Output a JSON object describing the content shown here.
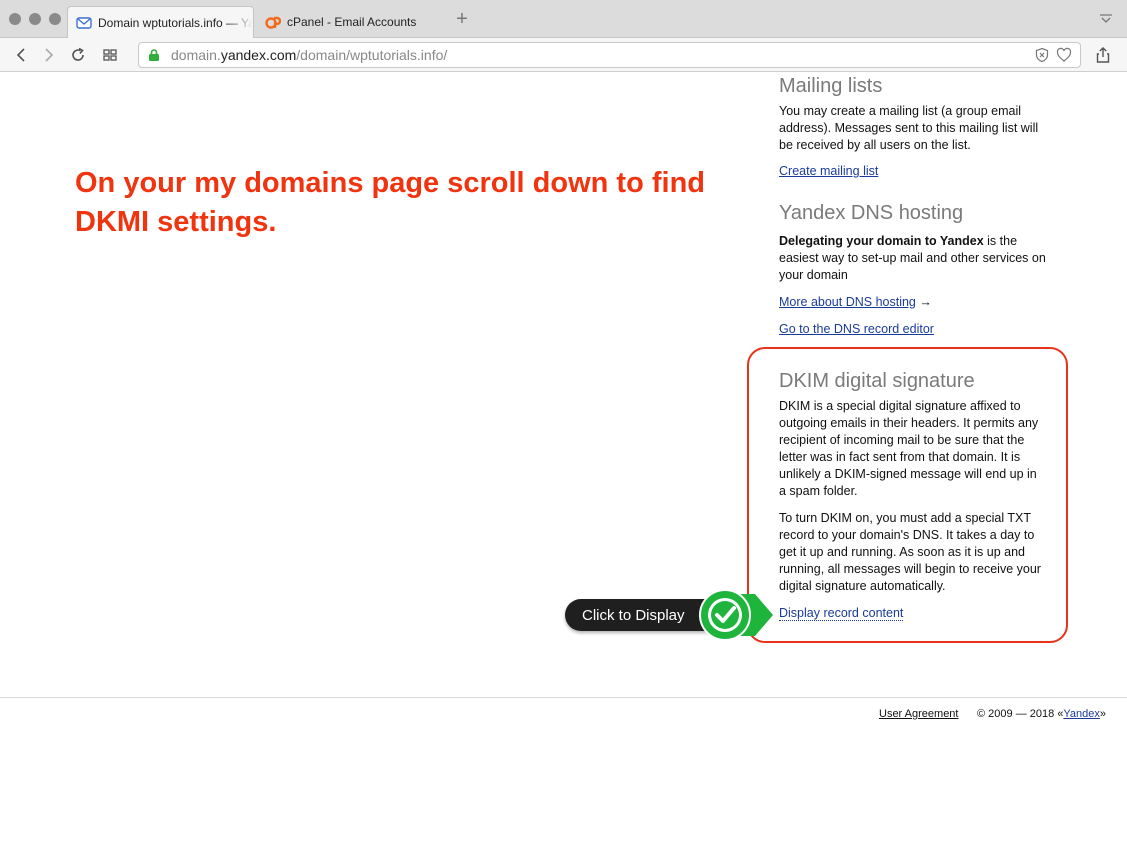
{
  "browser": {
    "tabs": [
      {
        "title": "Domain wptutorials.info — Ya",
        "active": true,
        "icon": "mail-icon"
      },
      {
        "title": "cPanel - Email Accounts",
        "active": false,
        "icon": "cpanel-icon"
      }
    ],
    "address": {
      "prefix": "domain.",
      "host": "yandex.com",
      "path": "/domain/wptutorials.info/"
    }
  },
  "annotation": {
    "text": "On your my domains page scroll down to find DKMI settings."
  },
  "mailing_lists": {
    "title": "Mailing lists",
    "description": "You may create a mailing list (a group email address). Messages sent to this mailing list will be received by all users on the list.",
    "create_link": "Create mailing list"
  },
  "dns_hosting": {
    "title": "Yandex DNS hosting",
    "lead_bold": "Delegating your domain to Yandex",
    "lead_rest": " is the easiest way to set-up mail and other services on your domain",
    "more_link": "More about DNS hosting",
    "arrow": "→",
    "editor_link": "Go to the DNS record editor"
  },
  "dkim": {
    "title": "DKIM digital signature",
    "para1": "DKIM is a special digital signature affixed to outgoing emails in their headers. It permits any recipient of incoming mail to be sure that the letter was in fact sent from that domain. It is unlikely a DKIM-signed message will end up in a spam folder.",
    "para2": "To turn DKIM on, you must add a special TXT record to your domain's DNS. It takes a day to get it up and running. As soon as it is up and running, all messages will begin to receive your digital signature automatically.",
    "display_link": "Display record content"
  },
  "callout": {
    "label": "Click to Display"
  },
  "footer": {
    "user_agreement": "User Agreement",
    "copyright_prefix": "© 2009 — 2018 «",
    "yandex_link": "Yandex",
    "copyright_suffix": "»"
  },
  "colors": {
    "annotation_red": "#f0340f",
    "frame_red": "#e8331a",
    "link_blue": "#1a3b9a",
    "check_green": "#1fb53d"
  }
}
